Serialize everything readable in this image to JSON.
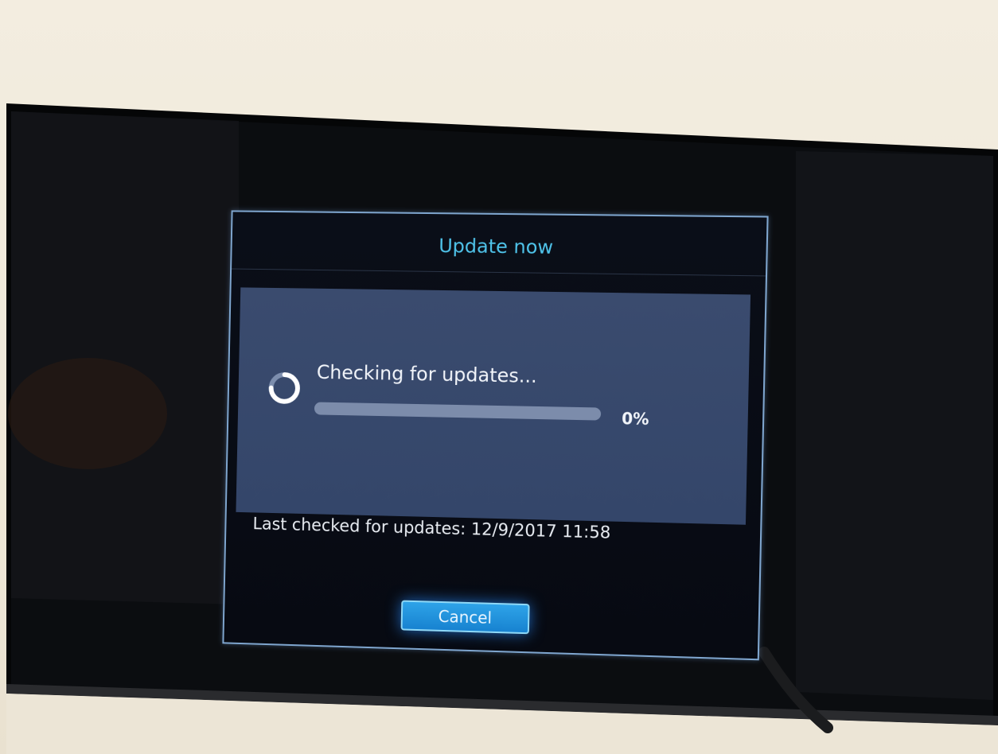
{
  "dialog": {
    "title": "Update now",
    "status_text": "Checking for updates...",
    "progress_fraction": 0,
    "progress_label": "0%",
    "last_checked": "Last checked for updates: 12/9/2017 11:58",
    "cancel_label": "Cancel"
  },
  "colors": {
    "title": "#4fc3ea",
    "panel": "#3a4b6e",
    "button": "#1e90e0",
    "border": "#7fa6cf"
  },
  "icons": {
    "spinner": "loading-spinner-icon"
  }
}
